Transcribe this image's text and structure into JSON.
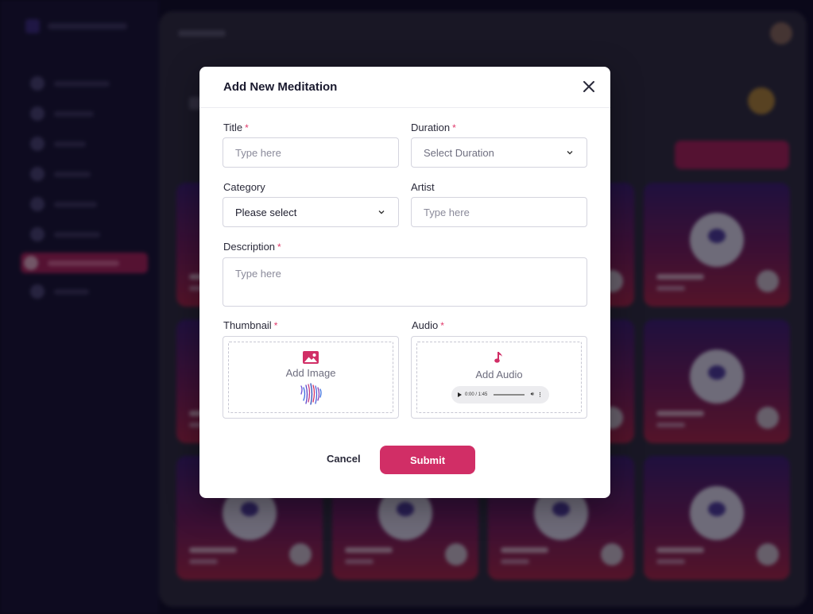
{
  "modal": {
    "title": "Add New Meditation",
    "close_icon": "close-icon"
  },
  "form": {
    "title": {
      "label": "Title",
      "required": "*",
      "placeholder": "Type here",
      "value": ""
    },
    "duration": {
      "label": "Duration",
      "required": "*",
      "selected": "Select Duration"
    },
    "category": {
      "label": "Category",
      "selected": "Please select"
    },
    "artist": {
      "label": "Artist",
      "placeholder": "Type here",
      "value": ""
    },
    "description": {
      "label": "Description",
      "required": "*",
      "placeholder": "Type here",
      "value": ""
    },
    "thumbnail": {
      "label": "Thumbnail",
      "required": "*",
      "action_text": "Add Image",
      "icon": "image-icon"
    },
    "audio": {
      "label": "Audio",
      "required": "*",
      "action_text": "Add Audio",
      "icon": "music-note-icon",
      "player_time": "0:00 / 1:45"
    }
  },
  "actions": {
    "cancel_label": "Cancel",
    "submit_label": "Submit"
  },
  "colors": {
    "accent": "#d12e66",
    "required": "#e0386a",
    "sidebar_bg": "#15112b"
  }
}
